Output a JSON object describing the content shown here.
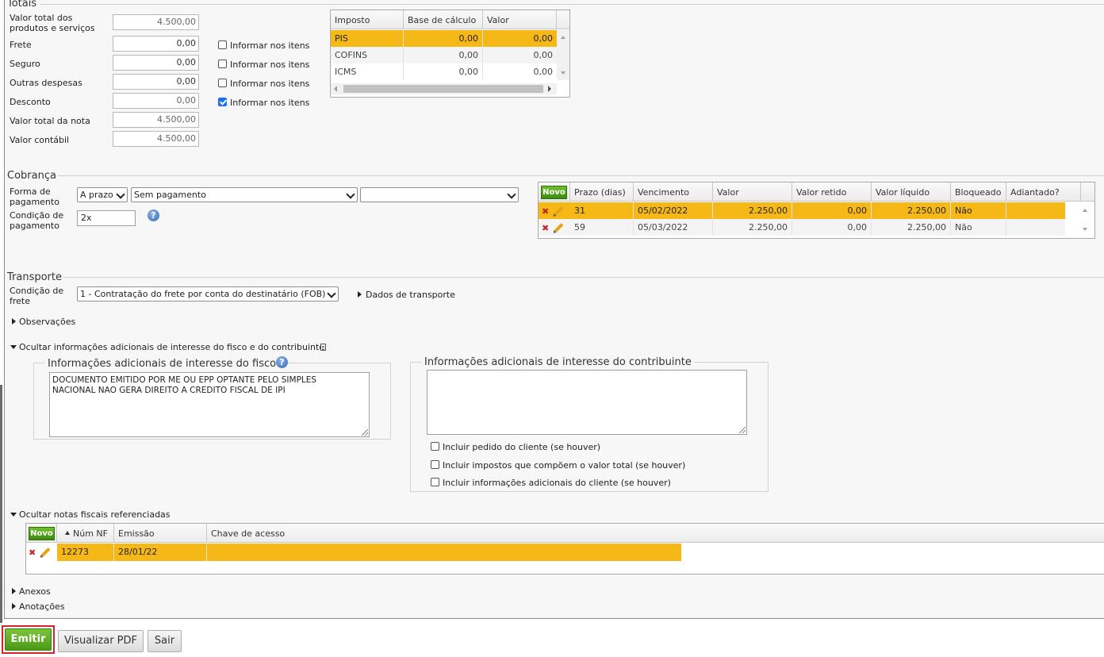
{
  "totais": {
    "title": "Totais",
    "fields": [
      {
        "label": "Valor total dos produtos e serviços",
        "value": "4.500,00"
      },
      {
        "label": "Frete",
        "value": "0,00",
        "check_label": "Informar nos itens",
        "checked": false
      },
      {
        "label": "Seguro",
        "value": "0,00",
        "check_label": "Informar nos itens",
        "checked": false
      },
      {
        "label": "Outras despesas",
        "value": "0,00",
        "check_label": "Informar nos itens",
        "checked": false
      },
      {
        "label": "Desconto",
        "value": "0,00",
        "check_label": "Informar nos itens",
        "checked": true
      },
      {
        "label": "Valor total da nota",
        "value": "4.500,00"
      },
      {
        "label": "Valor contábil",
        "value": "4.500,00"
      }
    ],
    "impostos": {
      "columns": [
        "Imposto",
        "Base de cálculo",
        "Valor"
      ],
      "rows": [
        {
          "imposto": "PIS",
          "base": "0,00",
          "valor": "0,00"
        },
        {
          "imposto": "COFINS",
          "base": "0,00",
          "valor": "0,00"
        },
        {
          "imposto": "ICMS",
          "base": "0,00",
          "valor": "0,00"
        }
      ]
    }
  },
  "cobranca": {
    "title": "Cobrança",
    "forma_label": "Forma de pagamento",
    "forma_value": "A prazo",
    "meio_value": "Sem pagamento",
    "extra_value": "",
    "condicao_label": "Condição de pagamento",
    "condicao_value": "2x",
    "help": "?",
    "grid": {
      "novo": "Novo",
      "columns": [
        "Prazo (dias)",
        "Vencimento",
        "Valor",
        "Valor retido",
        "Valor líquido",
        "Bloqueado",
        "Adiantado?"
      ],
      "rows": [
        {
          "prazo": "31",
          "vencimento": "05/02/2022",
          "valor": "2.250,00",
          "retido": "0,00",
          "liquido": "2.250,00",
          "bloqueado": "Não",
          "adiantado": ""
        },
        {
          "prazo": "59",
          "vencimento": "05/03/2022",
          "valor": "2.250,00",
          "retido": "0,00",
          "liquido": "2.250,00",
          "bloqueado": "Não",
          "adiantado": ""
        }
      ]
    }
  },
  "transporte": {
    "title": "Transporte",
    "condicao_label": "Condição de frete",
    "condicao_value": "1 - Contratação do frete por conta do destinatário (FOB)",
    "dados_link": "Dados de transporte"
  },
  "observacoes_link": "Observações",
  "info_adicionais": {
    "toggle": "Ocultar informações adicionais de interesse do fisco e do contribuinte",
    "fisco_legend": "Informações adicionais de interesse do fisco",
    "fisco_text": "DOCUMENTO EMITIDO POR ME OU EPP OPTANTE PELO SIMPLES\nNACIONAL NAO GERA DIREITO A CREDITO FISCAL DE IPI",
    "contrib_legend": "Informações adicionais de interesse do contribuinte",
    "contrib_text": "",
    "checks": [
      {
        "label": "Incluir pedido do cliente (se houver)",
        "checked": false
      },
      {
        "label": "Incluir impostos que compõem o valor total (se houver)",
        "checked": false
      },
      {
        "label": "Incluir informações adicionais do cliente (se houver)",
        "checked": false
      }
    ]
  },
  "notas_ref": {
    "toggle": "Ocultar notas fiscais referenciadas",
    "novo": "Novo",
    "columns": [
      "Núm NF",
      "Emissão",
      "Chave de acesso"
    ],
    "rows": [
      {
        "num": "12273",
        "emissao": "28/01/22",
        "chave": ""
      }
    ]
  },
  "anexos_link": "Anexos",
  "anotacoes_link": "Anotações",
  "buttons": {
    "emitir": "Emitir",
    "visualizar": "Visualizar PDF",
    "sair": "Sair"
  },
  "colors": {
    "selected_row": "#f6b817",
    "primary_button": "#5aa81f",
    "highlight_border": "#d9232a"
  }
}
